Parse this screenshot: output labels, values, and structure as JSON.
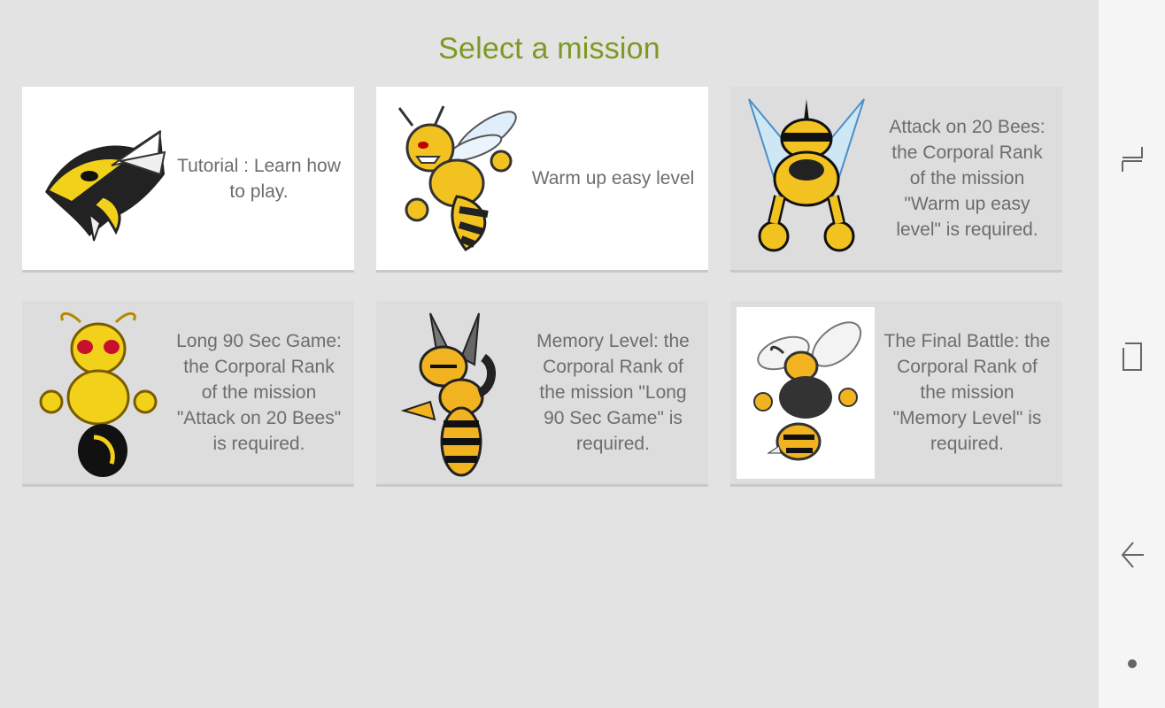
{
  "header": {
    "title": "Select a mission"
  },
  "colors": {
    "title": "#7c9a22",
    "background": "#e3e3e3",
    "card_unlocked": "#ffffff",
    "card_locked": "#dddddd",
    "text": "#6d6d6d",
    "navbar": "#f5f5f5"
  },
  "missions": [
    {
      "label": "Tutorial : Learn how to play.",
      "state": "unlocked",
      "icon": "hornet-head-icon"
    },
    {
      "label": "Warm up easy level",
      "state": "unlocked",
      "icon": "angry-bee-icon"
    },
    {
      "label": "Attack on 20 Bees: the Corporal Rank of the mission \"Warm up easy level\" is required.",
      "state": "locked",
      "icon": "muscle-bee-icon"
    },
    {
      "label": "Long 90 Sec Game: the Corporal Rank of the mission \"Attack on 20 Bees\" is required.",
      "state": "locked",
      "icon": "red-eyed-wasp-icon"
    },
    {
      "label": "Memory Level: the Corporal Rank of the mission \"Long 90 Sec Game\" is required.",
      "state": "locked",
      "icon": "pointing-bee-icon"
    },
    {
      "label": "The Final Battle: the Corporal Rank of the mission \"Memory Level\" is required.",
      "state": "locked",
      "icon": "hornet-fighter-icon"
    }
  ],
  "navigation_bar": {
    "buttons": [
      "recent-apps-icon",
      "home-icon",
      "back-icon",
      "dot-icon"
    ]
  }
}
